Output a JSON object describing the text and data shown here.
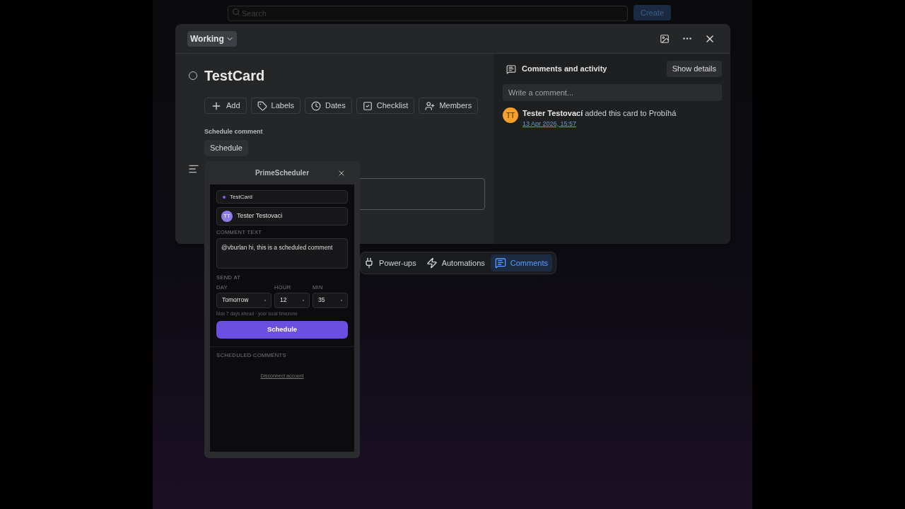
{
  "top_bar": {
    "search": {
      "placeholder": "Search"
    },
    "create_button": "Create"
  },
  "card": {
    "list_button": "Working",
    "title": "TestCard",
    "complete": false,
    "actions": [
      {
        "kind": "add",
        "label": "Add"
      },
      {
        "kind": "labels",
        "label": "Labels"
      },
      {
        "kind": "dates",
        "label": "Dates"
      },
      {
        "kind": "checklist",
        "label": "Checklist"
      },
      {
        "kind": "members",
        "label": "Members"
      }
    ],
    "schedule_section": {
      "heading": "Schedule comment",
      "button": "Schedule"
    }
  },
  "activity": {
    "title": "Comments and activity",
    "details_button": "Show details",
    "comment_placeholder": "Write a comment...",
    "entries": [
      {
        "initials": "TT",
        "author": "Tester Testovací",
        "text": "added this card to Probíhá",
        "time": "13 Apr 2026, 15:57"
      }
    ]
  },
  "board_toolbar": [
    {
      "kind": "powerups",
      "label": "Power-ups",
      "selected": false
    },
    {
      "kind": "automations",
      "label": "Automations",
      "selected": false
    },
    {
      "kind": "comments",
      "label": "Comments",
      "selected": true
    }
  ],
  "scheduler": {
    "title": "PrimeScheduler",
    "card_name": "TestCard",
    "user": {
      "initials": "TT",
      "name": "Tester Testovaci"
    },
    "comment_label": "COMMENT TEXT",
    "comment_text": "@vburlan hi, this is a scheduled comment",
    "send_at_label": "SEND AT",
    "fields": [
      {
        "label": "DAY",
        "value": "Tomorrow"
      },
      {
        "label": "HOUR",
        "value": "12"
      },
      {
        "label": "MIN",
        "value": "35"
      }
    ],
    "hint": "Max 7 days ahead · your local timezone",
    "schedule_button": "Schedule",
    "scheduled_label": "SCHEDULED COMMENTS",
    "disconnect_link": "Disconnect account"
  }
}
